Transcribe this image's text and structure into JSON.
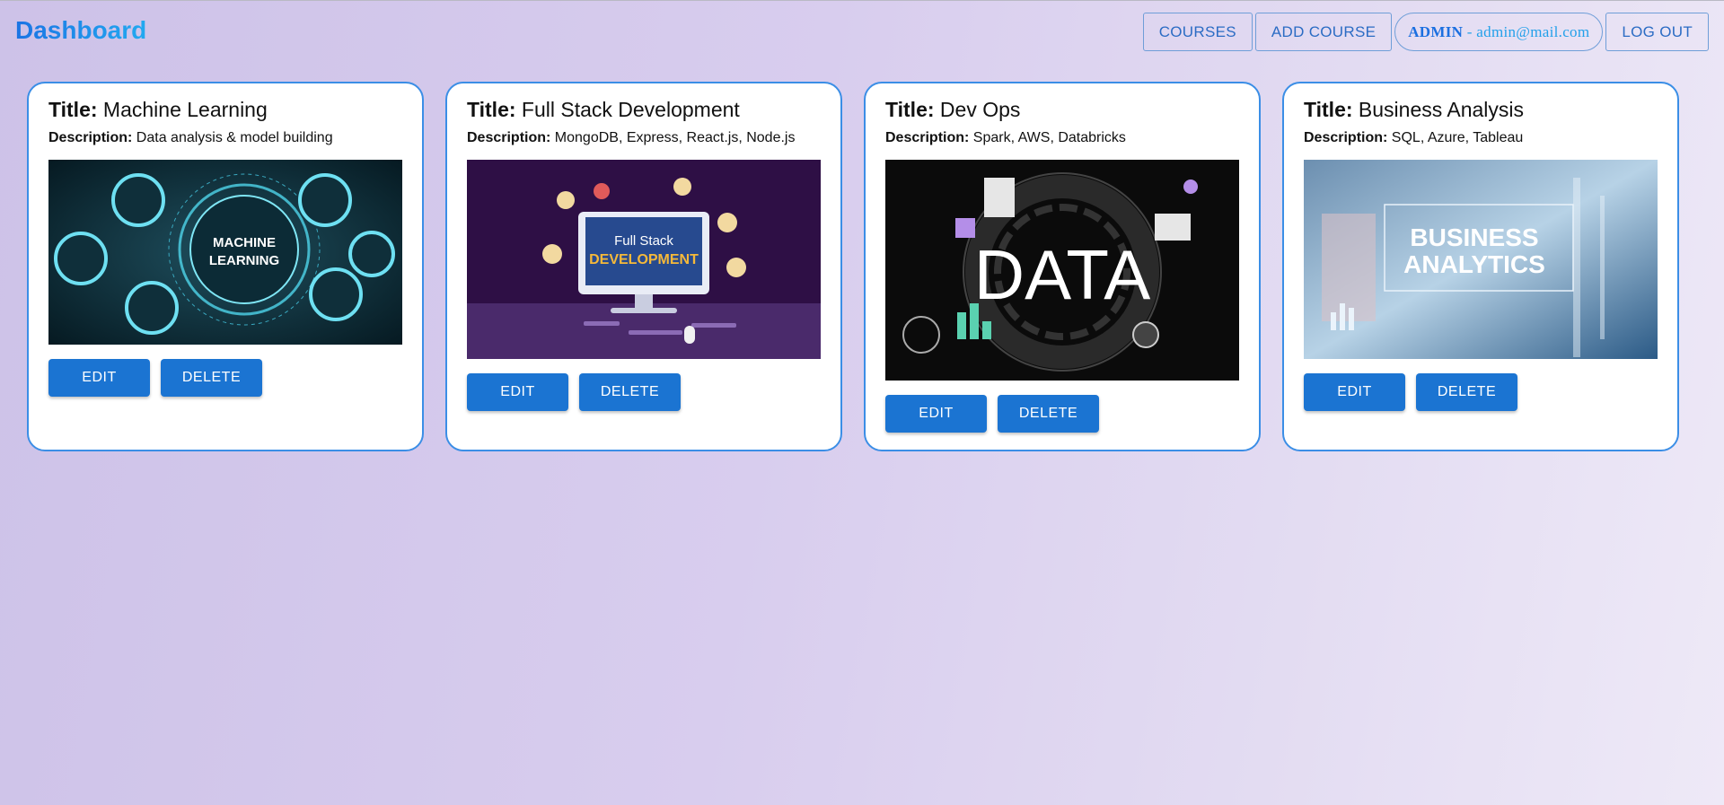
{
  "header": {
    "brand": "Dashboard",
    "nav": {
      "courses": "COURSES",
      "add_course": "ADD COURSE",
      "user_role": "ADMIN",
      "user_sep": " - ",
      "user_email": "admin@mail.com",
      "logout": "LOG OUT"
    }
  },
  "labels": {
    "title": "Title:",
    "description": "Description:",
    "edit": "EDIT",
    "delete": "DELETE"
  },
  "courses": [
    {
      "title": "Machine Learning",
      "description": "Data analysis & model building",
      "image_text": [
        "MACHINE",
        "LEARNING"
      ]
    },
    {
      "title": "Full Stack Development",
      "description": "MongoDB, Express, React.js, Node.js",
      "image_text": [
        "Full Stack",
        "DEVELOPMENT"
      ]
    },
    {
      "title": "Dev Ops",
      "description": "Spark, AWS, Databricks",
      "image_text": [
        "DATA"
      ]
    },
    {
      "title": "Business Analysis",
      "description": "SQL, Azure, Tableau",
      "image_text": [
        "BUSINESS",
        "ANALYTICS"
      ]
    }
  ],
  "colors": {
    "accent": "#1b74d2",
    "card_border": "#3b8ee6",
    "brand_start": "#1b74e4",
    "brand_end": "#22a9f0"
  }
}
